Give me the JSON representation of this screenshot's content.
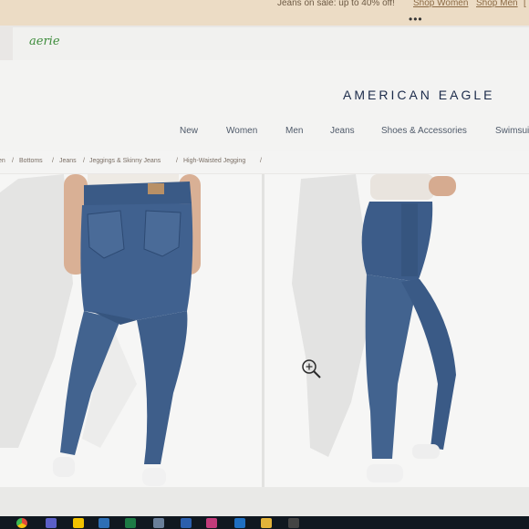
{
  "promo": {
    "text": "Jeans on sale: up to 40% off!",
    "links": [
      "Shop Women",
      "Shop Men",
      "["
    ],
    "dots": "•••"
  },
  "aerie": {
    "logo": "aerie"
  },
  "header": {
    "brand": "AMERICAN EAGLE",
    "nav": [
      "New",
      "Women",
      "Men",
      "Jeans",
      "Shoes & Accessories",
      "Swimsui"
    ]
  },
  "breadcrumb": [
    "en",
    "/",
    "Bottoms",
    "/",
    "Jeans",
    "/",
    "Jeggings & Skinny Jeans",
    "/",
    "High-Waisted Jegging",
    "/"
  ],
  "product": {
    "image_back_alt": "back view of high-waisted jeggings",
    "image_side_alt": "side view of high-waisted jeggings"
  },
  "colors": {
    "promo_bg": "#ecdcc5",
    "brand_navy": "#1c2b4a",
    "denim": "#3f5f8c",
    "aerie_green": "#3d8c3b"
  },
  "taskbar": {
    "icons": [
      "chrome-icon",
      "teams-icon",
      "files-icon",
      "stocks-icon",
      "excel-icon",
      "app-icon",
      "word-icon",
      "outlook-icon",
      "folder-icon",
      "settings-icon"
    ]
  }
}
